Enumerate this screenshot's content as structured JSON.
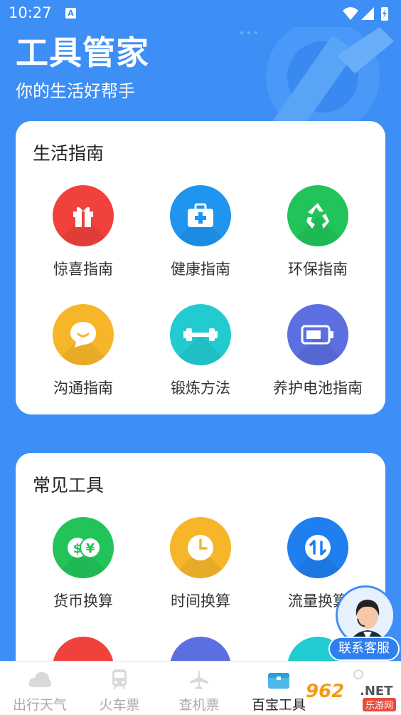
{
  "status_bar": {
    "time": "10:27"
  },
  "header": {
    "title": "工具管家",
    "subtitle": "你的生活好帮手"
  },
  "sections": [
    {
      "title": "生活指南",
      "items": [
        {
          "label": "惊喜指南",
          "icon": "gift-icon",
          "color": "#f0413c"
        },
        {
          "label": "健康指南",
          "icon": "medical-kit-icon",
          "color": "#1f95ef"
        },
        {
          "label": "环保指南",
          "icon": "recycle-icon",
          "color": "#22c45a"
        },
        {
          "label": "沟通指南",
          "icon": "chat-bubble-icon",
          "color": "#f7b52a"
        },
        {
          "label": "锻炼方法",
          "icon": "dumbbell-icon",
          "color": "#22cbd0"
        },
        {
          "label": "养护电池指南",
          "icon": "battery-icon",
          "color": "#5b6fe0"
        }
      ]
    },
    {
      "title": "常见工具",
      "items": [
        {
          "label": "货币换算",
          "icon": "currency-icon",
          "color": "#22c45a"
        },
        {
          "label": "时间换算",
          "icon": "clock-icon",
          "color": "#f7b52a"
        },
        {
          "label": "流量换算",
          "icon": "data-traffic-icon",
          "color": "#1f7fef"
        }
      ]
    }
  ],
  "floating_service": {
    "label": "联系客服"
  },
  "tabbar": [
    {
      "label": "出行天气",
      "icon": "cloud-icon",
      "active": false
    },
    {
      "label": "火车票",
      "icon": "train-icon",
      "active": false
    },
    {
      "label": "查机票",
      "icon": "airplane-icon",
      "active": false
    },
    {
      "label": "百宝工具",
      "icon": "toolbox-icon",
      "active": true
    },
    {
      "label": "",
      "icon": "user-icon",
      "active": false
    }
  ],
  "watermark": {
    "brand": "962",
    "domain": ".NET",
    "name": "乐游网"
  }
}
